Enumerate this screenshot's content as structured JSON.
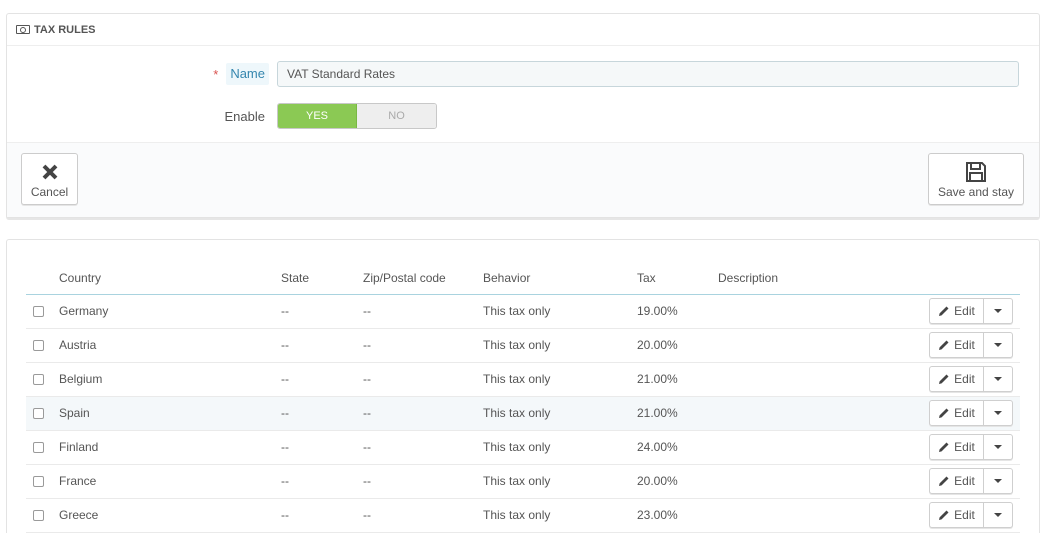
{
  "form_panel": {
    "heading_icon": "money-icon",
    "title": "TAX RULES",
    "name_label": "Name",
    "required_mark": "*",
    "name_value": "VAT Standard Rates",
    "enable_label": "Enable",
    "switch": {
      "yes": "YES",
      "no": "NO",
      "selected": "YES"
    },
    "cancel_label": "Cancel",
    "save_label": "Save and stay"
  },
  "table": {
    "headers": [
      "Country",
      "State",
      "Zip/Postal code",
      "Behavior",
      "Tax",
      "Description"
    ],
    "edit_label": "Edit",
    "rows": [
      {
        "country": "Germany",
        "state": "--",
        "zip": "--",
        "behavior": "This tax only",
        "tax": "19.00%",
        "description": ""
      },
      {
        "country": "Austria",
        "state": "--",
        "zip": "--",
        "behavior": "This tax only",
        "tax": "20.00%",
        "description": ""
      },
      {
        "country": "Belgium",
        "state": "--",
        "zip": "--",
        "behavior": "This tax only",
        "tax": "21.00%",
        "description": ""
      },
      {
        "country": "Spain",
        "state": "--",
        "zip": "--",
        "behavior": "This tax only",
        "tax": "21.00%",
        "description": ""
      },
      {
        "country": "Finland",
        "state": "--",
        "zip": "--",
        "behavior": "This tax only",
        "tax": "24.00%",
        "description": ""
      },
      {
        "country": "France",
        "state": "--",
        "zip": "--",
        "behavior": "This tax only",
        "tax": "20.00%",
        "description": ""
      },
      {
        "country": "Greece",
        "state": "--",
        "zip": "--",
        "behavior": "This tax only",
        "tax": "23.00%",
        "description": ""
      }
    ],
    "highlighted_row": 3
  },
  "colors": {
    "accent_green": "#8bc954",
    "required_red": "#d9534f",
    "label_hint_blue": "#3586ae",
    "header_border": "#a9d3df"
  }
}
